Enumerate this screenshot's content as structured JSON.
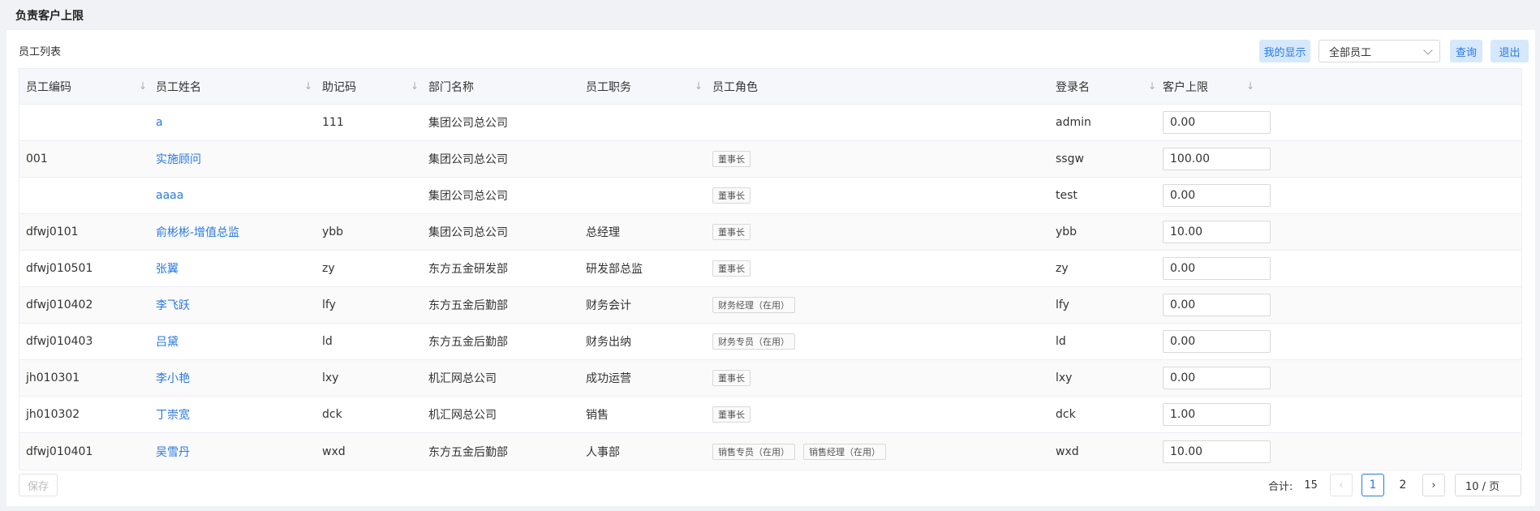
{
  "page_title": "负责客户上限",
  "section_title": "员工列表",
  "toolbar": {
    "my_display_label": "我的显示",
    "employee_filter_value": "全部员工",
    "query_label": "查询",
    "exit_label": "退出"
  },
  "table": {
    "columns": [
      {
        "label": "员工编码",
        "sortable": true
      },
      {
        "label": "员工姓名",
        "sortable": true
      },
      {
        "label": "助记码",
        "sortable": true
      },
      {
        "label": "部门名称",
        "sortable": false
      },
      {
        "label": "员工职务",
        "sortable": true
      },
      {
        "label": "员工角色",
        "sortable": false
      },
      {
        "label": "登录名",
        "sortable": true
      },
      {
        "label": "客户上限",
        "sortable": true
      }
    ],
    "rows": [
      {
        "code": "",
        "name": "a",
        "mnemonic": "111",
        "dept": "集团公司总公司",
        "position": "",
        "roles": [],
        "login": "admin",
        "limit": "0.00"
      },
      {
        "code": "001",
        "name": "实施顾问",
        "mnemonic": "",
        "dept": "集团公司总公司",
        "position": "",
        "roles": [
          "董事长"
        ],
        "login": "ssgw",
        "limit": "100.00"
      },
      {
        "code": "",
        "name": "aaaa",
        "mnemonic": "",
        "dept": "集团公司总公司",
        "position": "",
        "roles": [
          "董事长"
        ],
        "login": "test",
        "limit": "0.00"
      },
      {
        "code": "dfwj0101",
        "name": "俞彬彬-增值总监",
        "mnemonic": "ybb",
        "dept": "集团公司总公司",
        "position": "总经理",
        "roles": [
          "董事长"
        ],
        "login": "ybb",
        "limit": "10.00"
      },
      {
        "code": "dfwj010501",
        "name": "张翼",
        "mnemonic": "zy",
        "dept": "东方五金研发部",
        "position": "研发部总监",
        "roles": [
          "董事长"
        ],
        "login": "zy",
        "limit": "0.00"
      },
      {
        "code": "dfwj010402",
        "name": "李飞跃",
        "mnemonic": "lfy",
        "dept": "东方五金后勤部",
        "position": "财务会计",
        "roles": [
          "财务经理（在用）"
        ],
        "login": "lfy",
        "limit": "0.00"
      },
      {
        "code": "dfwj010403",
        "name": "吕黛",
        "mnemonic": "ld",
        "dept": "东方五金后勤部",
        "position": "财务出纳",
        "roles": [
          "财务专员（在用）"
        ],
        "login": "ld",
        "limit": "0.00"
      },
      {
        "code": "jh010301",
        "name": "李小艳",
        "mnemonic": "lxy",
        "dept": "机汇网总公司",
        "position": "成功运营",
        "roles": [
          "董事长"
        ],
        "login": "lxy",
        "limit": "0.00"
      },
      {
        "code": "jh010302",
        "name": "丁崇宽",
        "mnemonic": "dck",
        "dept": "机汇网总公司",
        "position": "销售",
        "roles": [
          "董事长"
        ],
        "login": "dck",
        "limit": "1.00"
      },
      {
        "code": "dfwj010401",
        "name": "吴雪丹",
        "mnemonic": "wxd",
        "dept": "东方五金后勤部",
        "position": "人事部",
        "roles": [
          "销售专员（在用）",
          "销售经理（在用）"
        ],
        "login": "wxd",
        "limit": "10.00"
      }
    ]
  },
  "footer": {
    "save_label": "保存",
    "total_label": "合计:",
    "total_count": "15",
    "prev_icon": "chevron-left-icon",
    "next_icon": "chevron-right-icon",
    "pages": [
      "1",
      "2"
    ],
    "current_page": "1",
    "page_size_label": "10 / 页"
  },
  "colors": {
    "accent": "#2a7ae2",
    "button_bg": "#d6e8fb",
    "header_bg": "#f5f7fa"
  }
}
